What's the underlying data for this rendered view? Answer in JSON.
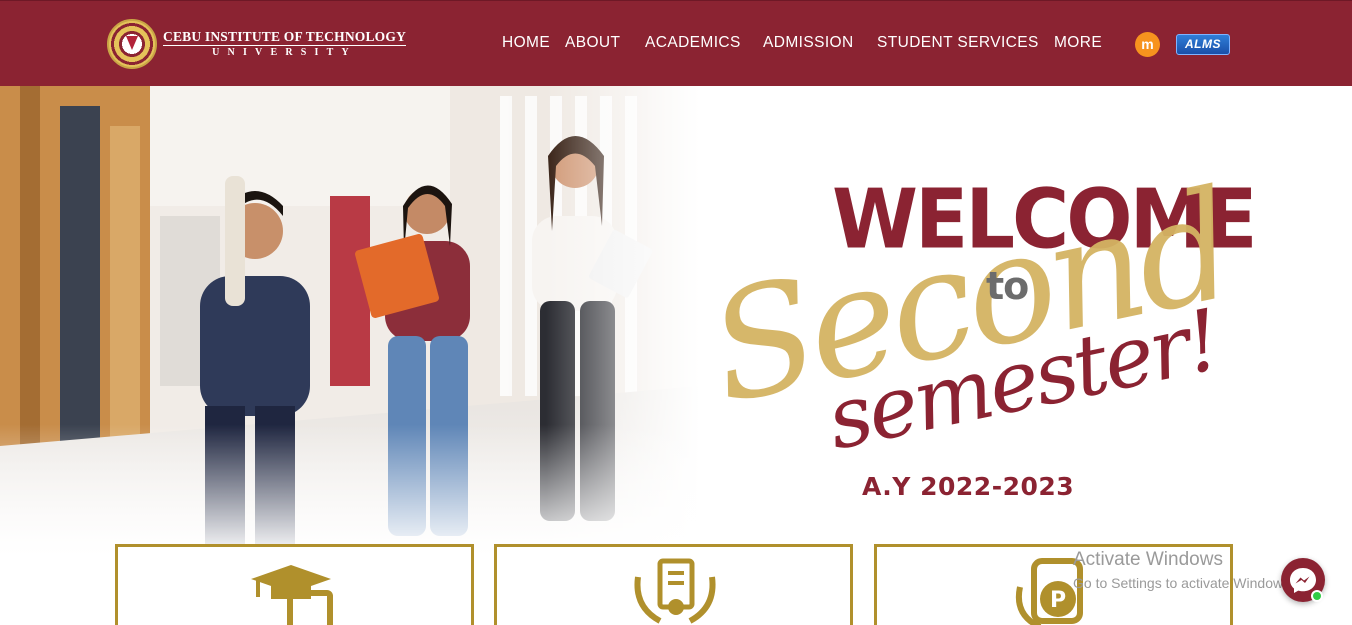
{
  "header": {
    "logo_line1": "CEBU INSTITUTE OF TECHNOLOGY",
    "logo_line2": "UNIVERSITY",
    "nav": [
      {
        "id": "home",
        "label": "HOME"
      },
      {
        "id": "about",
        "label": "ABOUT"
      },
      {
        "id": "academics",
        "label": "ACADEMICS"
      },
      {
        "id": "admission",
        "label": "ADMISSION"
      },
      {
        "id": "student-services",
        "label": "STUDENT SERVICES"
      },
      {
        "id": "more",
        "label": "MORE"
      }
    ],
    "moodle_glyph": "m",
    "alms_label": "ALMS",
    "bar_color": "#8b2332"
  },
  "hero": {
    "welcome": "WELCOME",
    "to": "to",
    "second": "Second",
    "semester": "semester!",
    "academic_year": "A.Y 2022-2023",
    "maroon": "#8b2332",
    "gold": "#d4b463"
  },
  "cards": [
    {
      "icon": "graduation-cap-icon"
    },
    {
      "icon": "certificate-award-icon"
    },
    {
      "icon": "scholarship-payment-icon"
    }
  ],
  "overlay": {
    "activate_title": "Activate Windows",
    "activate_sub": "Go to Settings to activate Windows.",
    "messenger_icon": "messenger-icon"
  }
}
